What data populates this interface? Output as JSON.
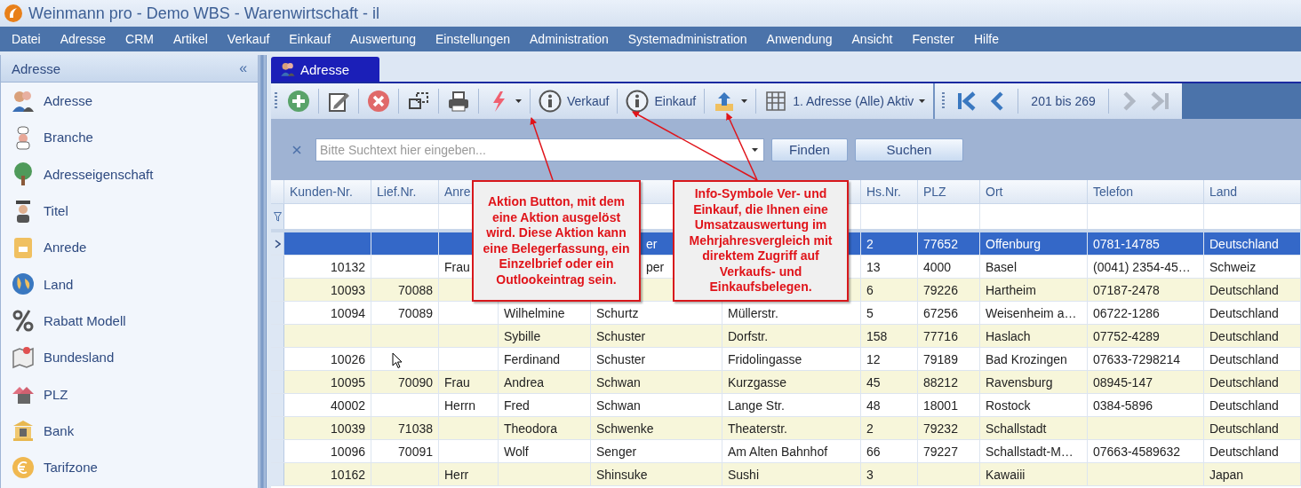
{
  "window": {
    "title": "Weinmann pro - Demo WBS - Warenwirtschaft - il"
  },
  "menu": [
    "Datei",
    "Adresse",
    "CRM",
    "Artikel",
    "Verkauf",
    "Einkauf",
    "Auswertung",
    "Einstellungen",
    "Administration",
    "Systemadministration",
    "Anwendung",
    "Ansicht",
    "Fenster",
    "Hilfe"
  ],
  "sidebar": {
    "title": "Adresse",
    "collapse": "«",
    "items": [
      {
        "label": "Adresse"
      },
      {
        "label": "Branche"
      },
      {
        "label": "Adresseigenschaft"
      },
      {
        "label": "Titel"
      },
      {
        "label": "Anrede"
      },
      {
        "label": "Land"
      },
      {
        "label": "Rabatt Modell"
      },
      {
        "label": "Bundesland"
      },
      {
        "label": "PLZ"
      },
      {
        "label": "Bank"
      },
      {
        "label": "Tarifzone"
      }
    ]
  },
  "tabs": [
    {
      "label": "Adresse",
      "selected": true
    }
  ],
  "toolbar": {
    "items": [
      {
        "kind": "add"
      },
      {
        "kind": "edit"
      },
      {
        "kind": "delete"
      },
      {
        "kind": "copy"
      },
      {
        "kind": "print"
      },
      {
        "kind": "action"
      },
      {
        "kind": "info",
        "label": "Verkauf"
      },
      {
        "kind": "info",
        "label": "Einkauf"
      },
      {
        "kind": "export"
      },
      {
        "kind": "layout",
        "label": "1. Adresse (Alle) Aktiv"
      }
    ],
    "nav": [
      {
        "kind": "first",
        "disabled": false
      },
      {
        "kind": "prev",
        "disabled": false
      },
      {
        "kind": "range",
        "label": "201 bis 269"
      },
      {
        "kind": "next",
        "disabled": true
      },
      {
        "kind": "last",
        "disabled": true
      }
    ]
  },
  "search": {
    "placeholder": "Bitte Suchtext hier eingeben...",
    "buttons": [
      "Finden",
      "Suchen"
    ]
  },
  "table": {
    "columns": [
      {
        "label": "Kunden-Nr."
      },
      {
        "label": "Lief.Nr."
      },
      {
        "label": "Anre"
      },
      {},
      {},
      {},
      {
        "label": "Hs.Nr."
      },
      {
        "label": "PLZ"
      },
      {
        "label": "Ort"
      },
      {
        "label": "Telefon"
      },
      {
        "label": "Land"
      }
    ],
    "rows": [
      {
        "selected": true,
        "cells": [
          null,
          null,
          null,
          null,
          {
            "text": "er",
            "kind": "fragment"
          },
          null,
          "2",
          "77652",
          "Offenburg",
          "0781-14785",
          "Deutschland"
        ]
      },
      {
        "selected": false,
        "cells": [
          "10132",
          null,
          "Frau",
          null,
          {
            "text": "per",
            "kind": "fragment"
          },
          null,
          "13",
          "4000",
          "Basel",
          "(0041) 2354-45…",
          "Schweiz"
        ]
      },
      {
        "selected": false,
        "cells": [
          "10093",
          "70088",
          null,
          null,
          null,
          null,
          "6",
          "79226",
          "Hartheim",
          "07187-2478",
          "Deutschland"
        ]
      },
      {
        "selected": false,
        "cells": [
          "10094",
          "70089",
          null,
          "Wilhelmine",
          "Schurtz",
          "Müllerstr.",
          "5",
          "67256",
          "Weisenheim a…",
          "06722-1286",
          "Deutschland"
        ]
      },
      {
        "selected": false,
        "cells": [
          null,
          null,
          null,
          "Sybille",
          "Schuster",
          "Dorfstr.",
          "158",
          "77716",
          "Haslach",
          "07752-4289",
          "Deutschland"
        ]
      },
      {
        "selected": false,
        "cells": [
          "10026",
          null,
          null,
          "Ferdinand",
          "Schuster",
          "Fridolingasse",
          "12",
          "79189",
          "Bad Krozingen",
          "07633-7298214",
          "Deutschland"
        ]
      },
      {
        "selected": false,
        "cells": [
          "10095",
          "70090",
          "Frau",
          "Andrea",
          "Schwan",
          "Kurzgasse",
          "45",
          "88212",
          "Ravensburg",
          "08945-147",
          "Deutschland"
        ]
      },
      {
        "selected": false,
        "cells": [
          "40002",
          null,
          "Herrn",
          "Fred",
          "Schwan",
          "Lange Str.",
          "48",
          "18001",
          "Rostock",
          "0384-5896",
          "Deutschland"
        ]
      },
      {
        "selected": false,
        "cells": [
          "10039",
          "71038",
          null,
          "Theodora",
          "Schwenke",
          "Theaterstr.",
          "2",
          "79232",
          "Schallstadt",
          null,
          "Deutschland"
        ]
      },
      {
        "selected": false,
        "cells": [
          "10096",
          "70091",
          null,
          "Wolf",
          "Senger",
          "Am Alten Bahnhof",
          "66",
          "79227",
          "Schallstadt-M…",
          "07663-4589632",
          "Deutschland"
        ]
      },
      {
        "selected": false,
        "cells": [
          "10162",
          null,
          "Herr",
          null,
          "Shinsuke",
          "Sushi",
          "3",
          null,
          "Kawaiii",
          null,
          "Japan"
        ]
      }
    ]
  },
  "callouts": [
    {
      "text": "Aktion Button, mit dem eine Aktion ausgelöst wird. Diese Aktion kann eine Belegerfassung, ein Einzelbrief oder ein Outlookeintrag sein."
    },
    {
      "text": "Info-Symbole Ver- und Einkauf, die Ihnen eine Umsatzauswertung im Mehrjahresvergleich mit direktem Zugriff auf Verkaufs- und Einkaufsbelegen."
    }
  ]
}
